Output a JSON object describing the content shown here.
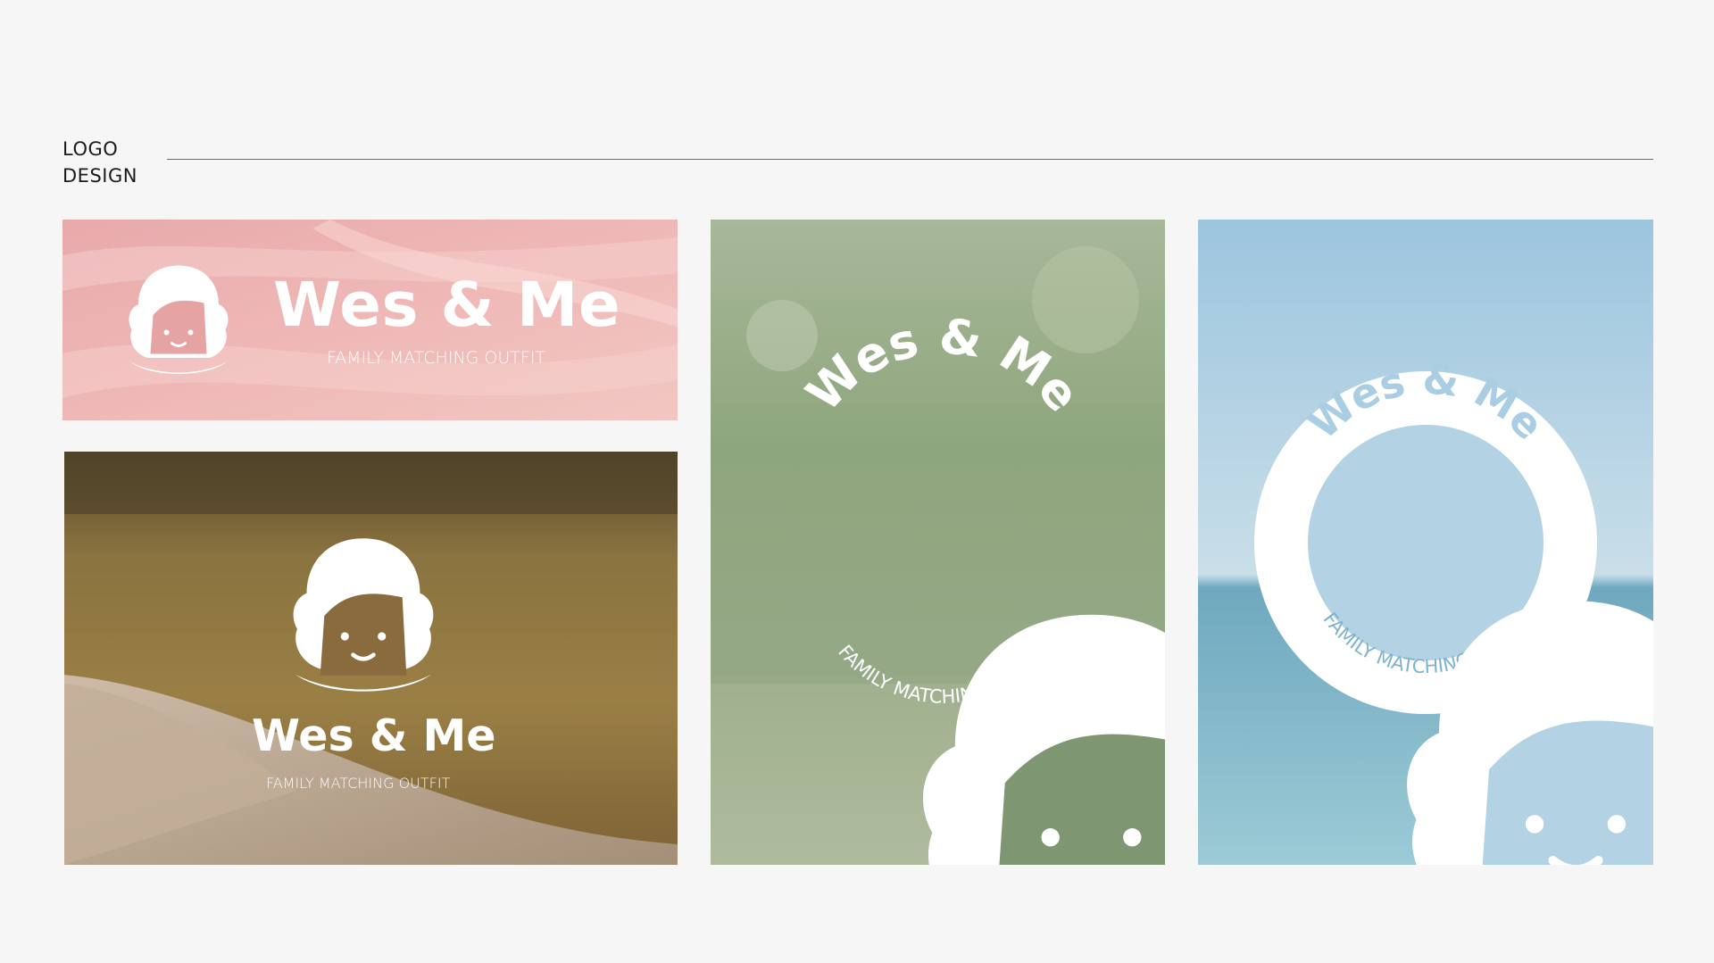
{
  "header": {
    "title_line1": "LOGO",
    "title_line2": "DESIGN"
  },
  "brand": {
    "name": "Wes & Me",
    "tagline": "FAMILY MATCHING OUTFIT"
  },
  "colors": {
    "page_background": "#f6f6f6",
    "logo_white": "#ffffff",
    "sea_logo_text": "#a9cde2",
    "sea_tagline_text": "#7fb2cf"
  },
  "panels": [
    {
      "id": "pink",
      "background": "pink fabric"
    },
    {
      "id": "field",
      "background": "blurred dry grass path"
    },
    {
      "id": "green",
      "background": "blurred green meadow"
    },
    {
      "id": "sea",
      "background": "blue sky over sea"
    }
  ]
}
